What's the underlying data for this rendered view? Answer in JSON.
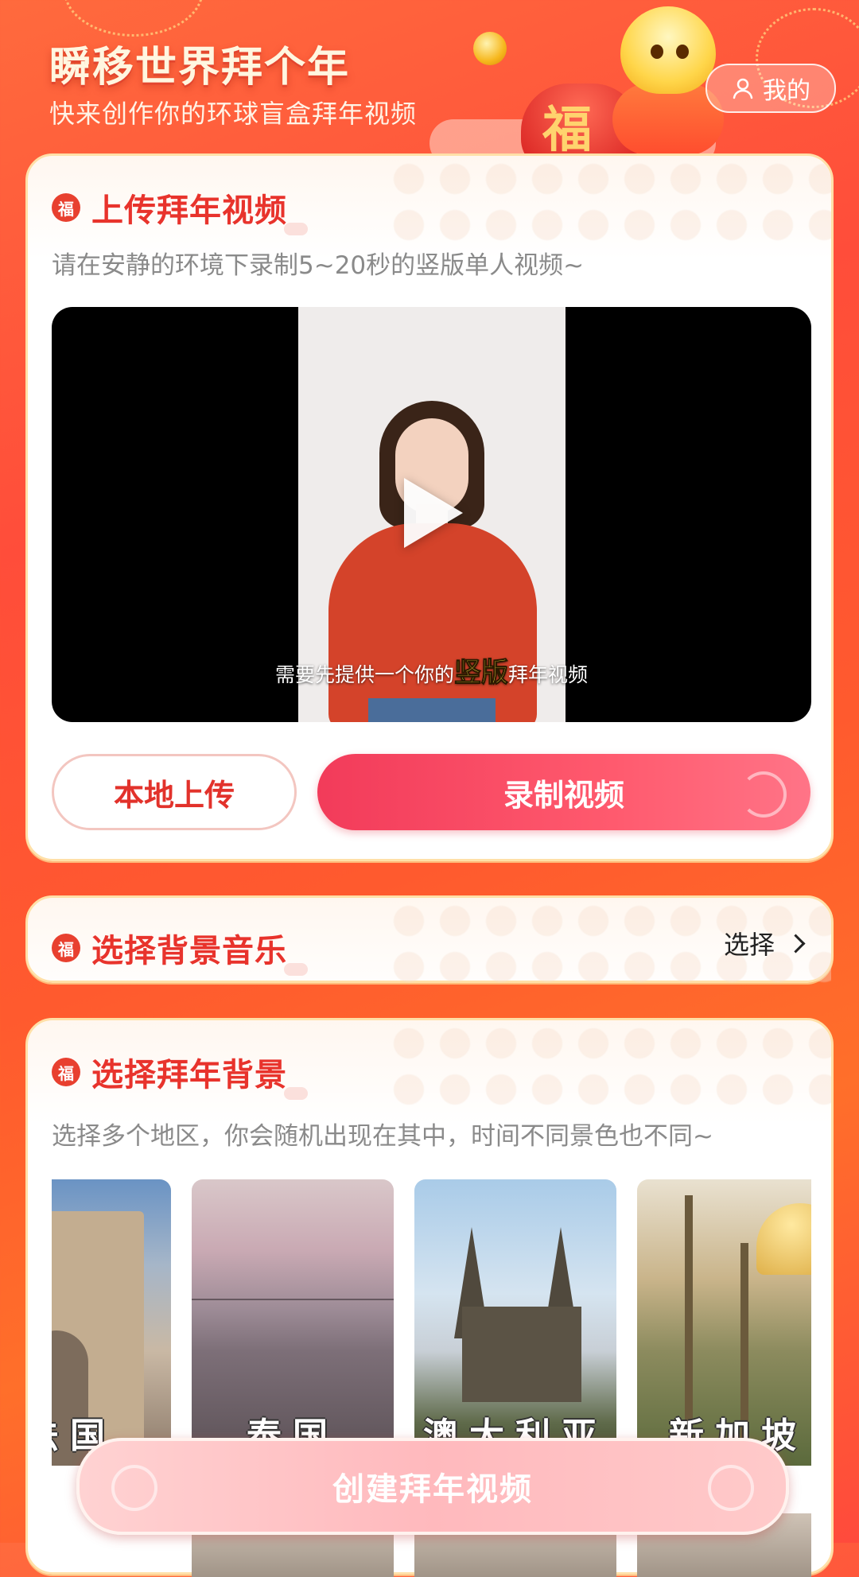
{
  "header": {
    "title": "瞬移世界拜个年",
    "subtitle": "快来创作你的环球盲盒拜年视频",
    "mascot_badge": "福",
    "mine_label": "我的"
  },
  "upload": {
    "badge": "福",
    "title": "上传拜年视频",
    "desc": "请在安静的环境下录制5~20秒的竖版单人视频~",
    "caption_before": "需要先提供一个你的",
    "caption_highlight": "竖版",
    "caption_after": "拜年视频",
    "local_upload_label": "本地上传",
    "record_label": "录制视频"
  },
  "music": {
    "badge": "福",
    "title": "选择背景音乐",
    "choose_label": "选择"
  },
  "background": {
    "badge": "福",
    "title": "选择拜年背景",
    "desc": "选择多个地区，你会随机出现在其中，时间不同景色也不同~",
    "places": [
      {
        "label": "法国"
      },
      {
        "label": "泰国"
      },
      {
        "label": "澳大利亚"
      },
      {
        "label": "新加坡"
      }
    ]
  },
  "create_label": "创建拜年视频",
  "colors": {
    "accent_red": "#e8332c",
    "record_button": "#f23b5a",
    "highlight_yellow": "#ffe14a"
  },
  "icons": [
    "user-icon",
    "play-icon",
    "chevron-right-icon",
    "fu-badge-icon"
  ]
}
